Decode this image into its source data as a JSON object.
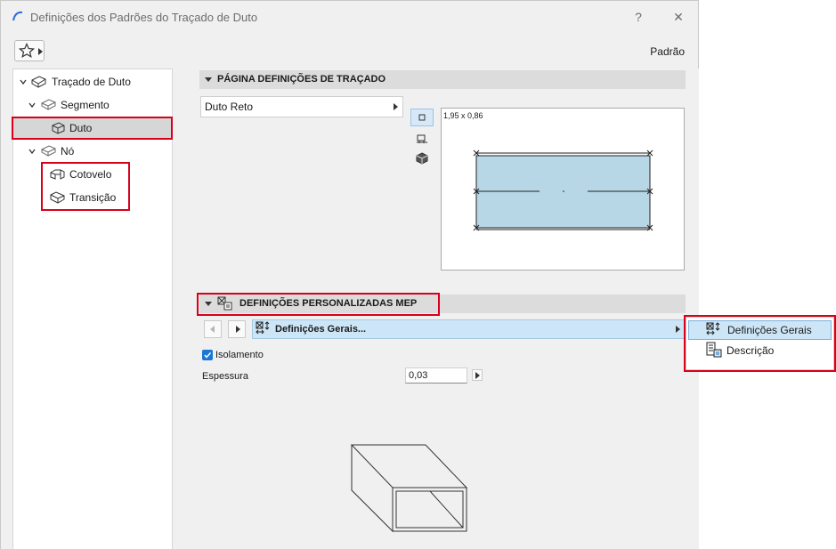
{
  "window": {
    "title": "Definições dos Padrões do Traçado de Duto",
    "help_glyph": "?",
    "close_glyph": "✕",
    "preset_label": "Padrão"
  },
  "tree": {
    "items": [
      {
        "label": "Traçado de Duto",
        "icon": "duct-route-icon"
      },
      {
        "label": "Segmento",
        "icon": "segment-icon"
      },
      {
        "label": "Duto",
        "icon": "duct-icon",
        "selected": true
      },
      {
        "label": "Nó",
        "icon": "node-icon"
      },
      {
        "label": "Cotovelo",
        "icon": "elbow-icon"
      },
      {
        "label": "Transição",
        "icon": "transition-icon"
      }
    ]
  },
  "section_route": {
    "title": "PÁGINA DEFINIÇÕES DE TRAÇADO",
    "type_value": "Duto Reto",
    "preview_size": "1,95 x 0,86"
  },
  "section_mep": {
    "title": "DEFINIÇÕES PERSONALIZADAS MEP",
    "page_label": "Definições Gerais...",
    "insulation_label": "Isolamento",
    "insulation_checked": true,
    "thickness_label": "Espessura",
    "thickness_value": "0,03"
  },
  "popup": {
    "items": [
      {
        "label": "Definições Gerais",
        "icon": "general-settings-icon",
        "highlighted": true
      },
      {
        "label": "Descrição",
        "icon": "description-icon"
      }
    ]
  },
  "colors": {
    "accent": "#1a78d4",
    "highlight_box": "#d9001b",
    "preview_fill": "#b7d7e6",
    "mep_bar": "#cde6f7"
  }
}
